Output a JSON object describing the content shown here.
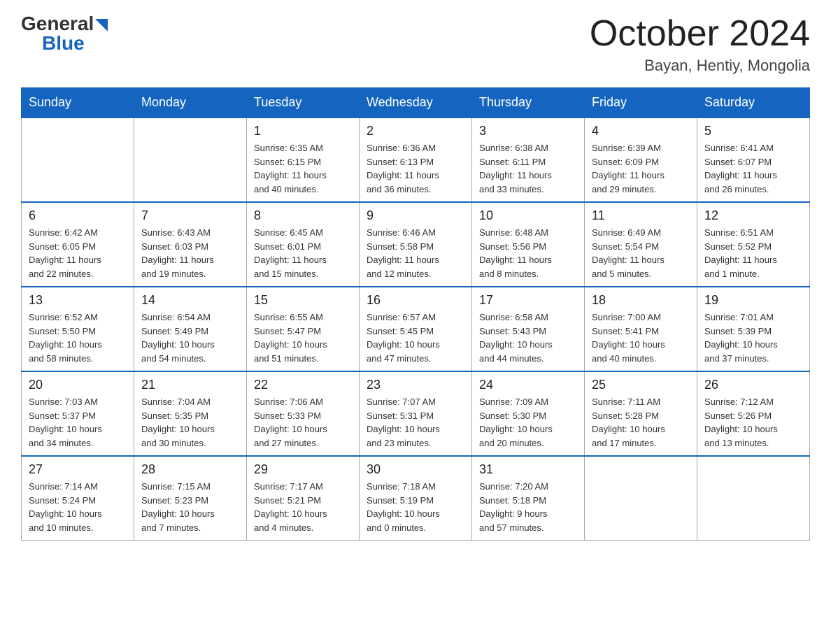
{
  "header": {
    "logo": {
      "general": "General",
      "triangle": "",
      "blue": "Blue"
    },
    "title": "October 2024",
    "location": "Bayan, Hentiy, Mongolia"
  },
  "weekdays": [
    "Sunday",
    "Monday",
    "Tuesday",
    "Wednesday",
    "Thursday",
    "Friday",
    "Saturday"
  ],
  "weeks": [
    [
      {
        "day": "",
        "info": ""
      },
      {
        "day": "",
        "info": ""
      },
      {
        "day": "1",
        "info": "Sunrise: 6:35 AM\nSunset: 6:15 PM\nDaylight: 11 hours\nand 40 minutes."
      },
      {
        "day": "2",
        "info": "Sunrise: 6:36 AM\nSunset: 6:13 PM\nDaylight: 11 hours\nand 36 minutes."
      },
      {
        "day": "3",
        "info": "Sunrise: 6:38 AM\nSunset: 6:11 PM\nDaylight: 11 hours\nand 33 minutes."
      },
      {
        "day": "4",
        "info": "Sunrise: 6:39 AM\nSunset: 6:09 PM\nDaylight: 11 hours\nand 29 minutes."
      },
      {
        "day": "5",
        "info": "Sunrise: 6:41 AM\nSunset: 6:07 PM\nDaylight: 11 hours\nand 26 minutes."
      }
    ],
    [
      {
        "day": "6",
        "info": "Sunrise: 6:42 AM\nSunset: 6:05 PM\nDaylight: 11 hours\nand 22 minutes."
      },
      {
        "day": "7",
        "info": "Sunrise: 6:43 AM\nSunset: 6:03 PM\nDaylight: 11 hours\nand 19 minutes."
      },
      {
        "day": "8",
        "info": "Sunrise: 6:45 AM\nSunset: 6:01 PM\nDaylight: 11 hours\nand 15 minutes."
      },
      {
        "day": "9",
        "info": "Sunrise: 6:46 AM\nSunset: 5:58 PM\nDaylight: 11 hours\nand 12 minutes."
      },
      {
        "day": "10",
        "info": "Sunrise: 6:48 AM\nSunset: 5:56 PM\nDaylight: 11 hours\nand 8 minutes."
      },
      {
        "day": "11",
        "info": "Sunrise: 6:49 AM\nSunset: 5:54 PM\nDaylight: 11 hours\nand 5 minutes."
      },
      {
        "day": "12",
        "info": "Sunrise: 6:51 AM\nSunset: 5:52 PM\nDaylight: 11 hours\nand 1 minute."
      }
    ],
    [
      {
        "day": "13",
        "info": "Sunrise: 6:52 AM\nSunset: 5:50 PM\nDaylight: 10 hours\nand 58 minutes."
      },
      {
        "day": "14",
        "info": "Sunrise: 6:54 AM\nSunset: 5:49 PM\nDaylight: 10 hours\nand 54 minutes."
      },
      {
        "day": "15",
        "info": "Sunrise: 6:55 AM\nSunset: 5:47 PM\nDaylight: 10 hours\nand 51 minutes."
      },
      {
        "day": "16",
        "info": "Sunrise: 6:57 AM\nSunset: 5:45 PM\nDaylight: 10 hours\nand 47 minutes."
      },
      {
        "day": "17",
        "info": "Sunrise: 6:58 AM\nSunset: 5:43 PM\nDaylight: 10 hours\nand 44 minutes."
      },
      {
        "day": "18",
        "info": "Sunrise: 7:00 AM\nSunset: 5:41 PM\nDaylight: 10 hours\nand 40 minutes."
      },
      {
        "day": "19",
        "info": "Sunrise: 7:01 AM\nSunset: 5:39 PM\nDaylight: 10 hours\nand 37 minutes."
      }
    ],
    [
      {
        "day": "20",
        "info": "Sunrise: 7:03 AM\nSunset: 5:37 PM\nDaylight: 10 hours\nand 34 minutes."
      },
      {
        "day": "21",
        "info": "Sunrise: 7:04 AM\nSunset: 5:35 PM\nDaylight: 10 hours\nand 30 minutes."
      },
      {
        "day": "22",
        "info": "Sunrise: 7:06 AM\nSunset: 5:33 PM\nDaylight: 10 hours\nand 27 minutes."
      },
      {
        "day": "23",
        "info": "Sunrise: 7:07 AM\nSunset: 5:31 PM\nDaylight: 10 hours\nand 23 minutes."
      },
      {
        "day": "24",
        "info": "Sunrise: 7:09 AM\nSunset: 5:30 PM\nDaylight: 10 hours\nand 20 minutes."
      },
      {
        "day": "25",
        "info": "Sunrise: 7:11 AM\nSunset: 5:28 PM\nDaylight: 10 hours\nand 17 minutes."
      },
      {
        "day": "26",
        "info": "Sunrise: 7:12 AM\nSunset: 5:26 PM\nDaylight: 10 hours\nand 13 minutes."
      }
    ],
    [
      {
        "day": "27",
        "info": "Sunrise: 7:14 AM\nSunset: 5:24 PM\nDaylight: 10 hours\nand 10 minutes."
      },
      {
        "day": "28",
        "info": "Sunrise: 7:15 AM\nSunset: 5:23 PM\nDaylight: 10 hours\nand 7 minutes."
      },
      {
        "day": "29",
        "info": "Sunrise: 7:17 AM\nSunset: 5:21 PM\nDaylight: 10 hours\nand 4 minutes."
      },
      {
        "day": "30",
        "info": "Sunrise: 7:18 AM\nSunset: 5:19 PM\nDaylight: 10 hours\nand 0 minutes."
      },
      {
        "day": "31",
        "info": "Sunrise: 7:20 AM\nSunset: 5:18 PM\nDaylight: 9 hours\nand 57 minutes."
      },
      {
        "day": "",
        "info": ""
      },
      {
        "day": "",
        "info": ""
      }
    ]
  ]
}
